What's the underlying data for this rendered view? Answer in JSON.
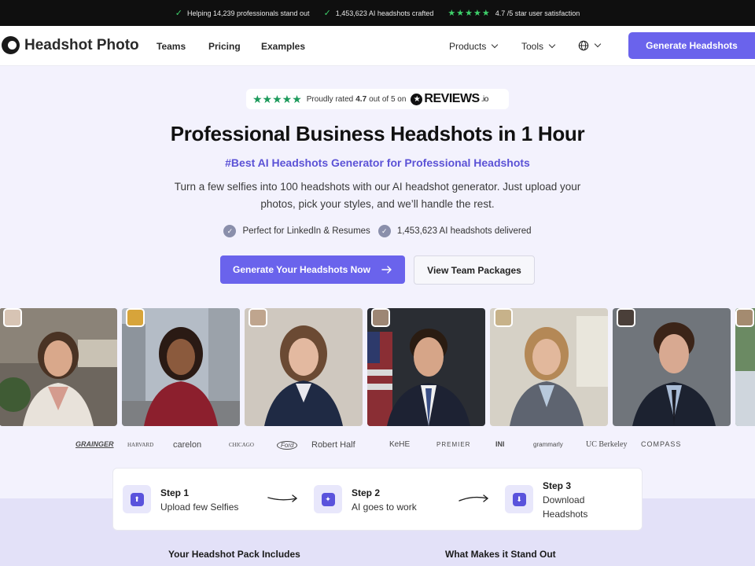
{
  "topbar": {
    "items": [
      "Helping 14,239 professionals stand out",
      "1,453,623 AI headshots crafted",
      "4.7 /5 star user satisfaction"
    ]
  },
  "nav": {
    "logo": "Headshot Photo",
    "links": [
      "Teams",
      "Pricing",
      "Examples"
    ],
    "products": "Products",
    "tools": "Tools",
    "cta": "Generate Headshots"
  },
  "rating": {
    "prefix": "Proudly rated",
    "score": "4.7",
    "suffix": "out of 5 on",
    "brand": "REVIEWS",
    "brand_suffix": ".io"
  },
  "hero": {
    "title": "Professional Business Headshots in 1 Hour",
    "tagline": "#Best AI Headshots Generator for Professional Headshots",
    "lead": "Turn a few selfies into 100 headshots with our AI headshot generator. Just upload your photos, pick your styles, and we’ll handle the rest.",
    "bullets": [
      "Perfect for LinkedIn & Resumes",
      "1,453,623 AI headshots delivered"
    ],
    "cta_primary": "Generate Your Headshots Now",
    "cta_secondary": "View Team Packages"
  },
  "client_logos": [
    "GRAINGER",
    "HARVARD",
    "carelon",
    "CHICAGO",
    "Ford",
    "Robert Half",
    "KeHE",
    "PREMIER",
    "INI",
    "grammarly",
    "UC Berkeley",
    "COMPASS"
  ],
  "steps": [
    {
      "title": "Step 1",
      "desc": "Upload few Selfies"
    },
    {
      "title": "Step 2",
      "desc": "AI goes to work"
    },
    {
      "title": "Step 3",
      "desc": "Download Headshots"
    }
  ],
  "sections": {
    "pack": "Your Headshot Pack Includes",
    "standout": "What Makes it Stand Out"
  },
  "colors": {
    "brand": "#6a63ec",
    "tagline": "#5b52d6",
    "topbar": "#0f0f0f",
    "check": "#3ecf6a"
  }
}
